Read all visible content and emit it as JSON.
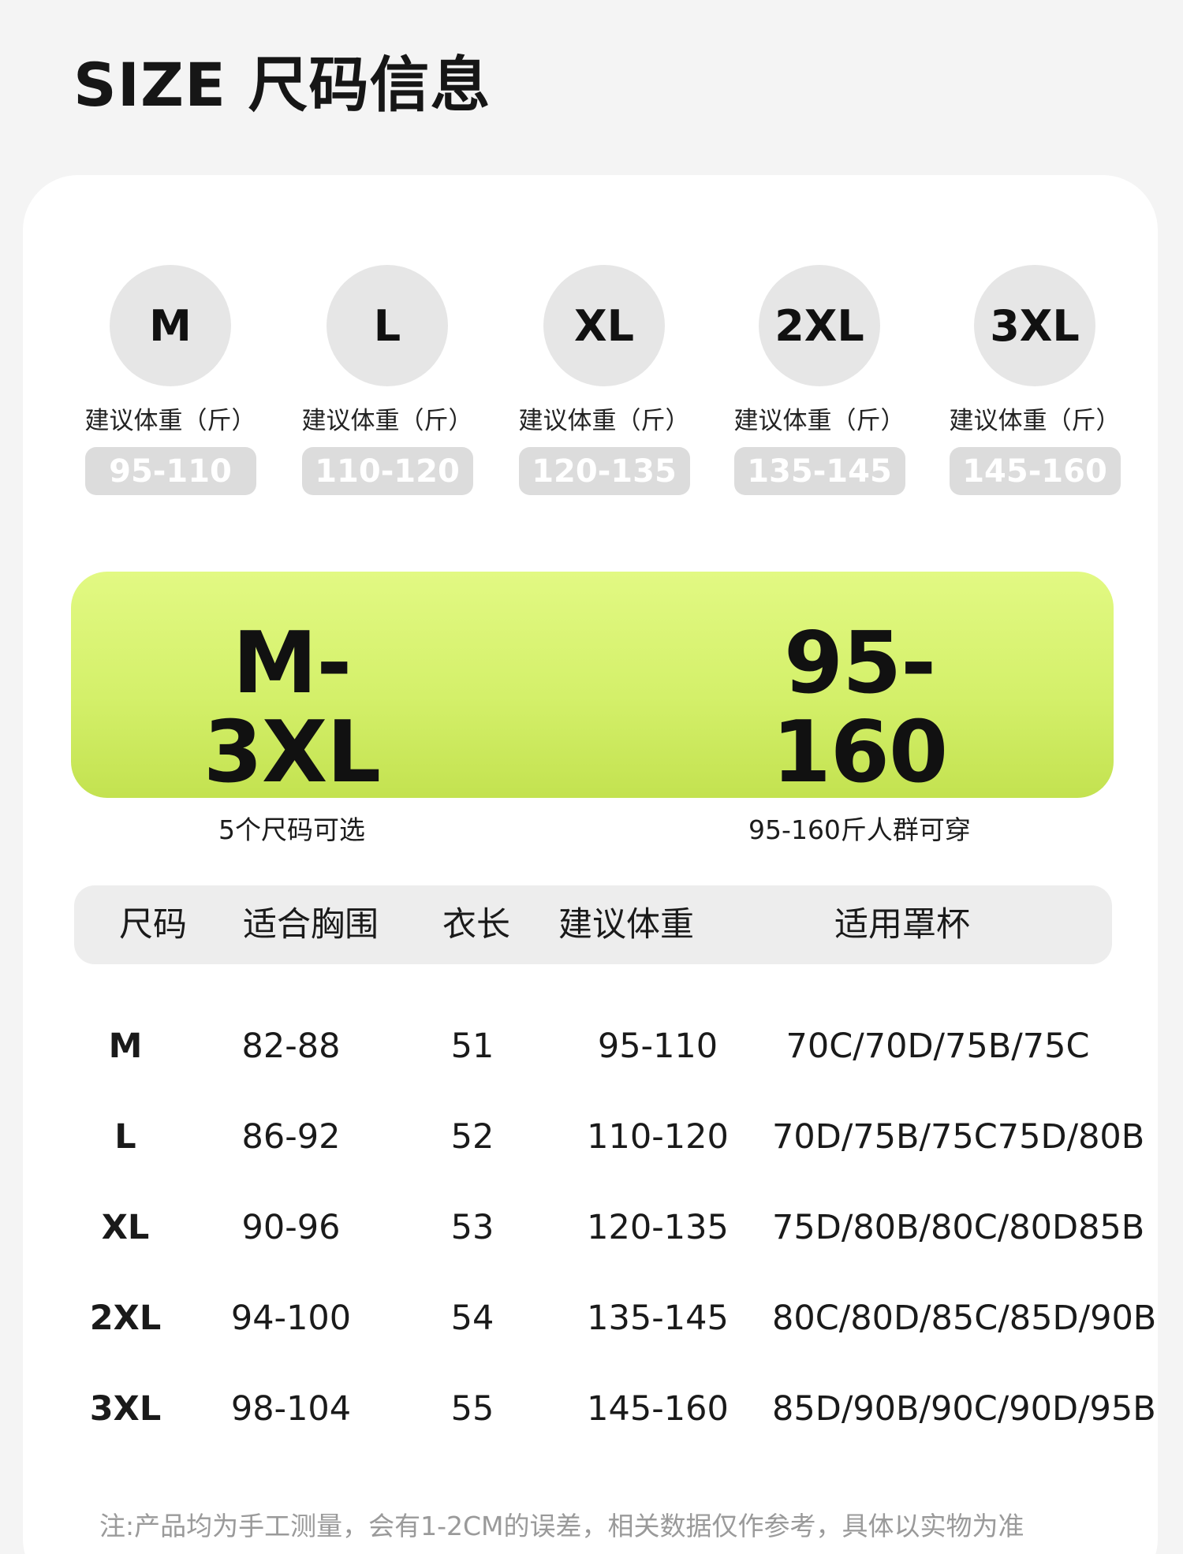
{
  "title": "SIZE 尺码信息",
  "sizes": [
    {
      "label": "M",
      "caption": "建议体重（斤）",
      "range": "95-110"
    },
    {
      "label": "L",
      "caption": "建议体重（斤）",
      "range": "110-120"
    },
    {
      "label": "XL",
      "caption": "建议体重（斤）",
      "range": "120-135"
    },
    {
      "label": "2XL",
      "caption": "建议体重（斤）",
      "range": "135-145"
    },
    {
      "label": "3XL",
      "caption": "建议体重（斤）",
      "range": "145-160"
    }
  ],
  "banner": {
    "left_big": "M-3XL",
    "left_small": "5个尺码可选",
    "right_big": "95-160",
    "right_small": "95-160斤人群可穿"
  },
  "table": {
    "headers": [
      "尺码",
      "适合胸围",
      "衣长",
      "建议体重",
      "适用罩杯"
    ],
    "rows": [
      [
        "M",
        "82-88",
        "51",
        "95-110",
        "70C/70D/75B/75C"
      ],
      [
        "L",
        "86-92",
        "52",
        "110-120",
        "70D/75B/75C75D/80B"
      ],
      [
        "XL",
        "90-96",
        "53",
        "120-135",
        "75D/80B/80C/80D85B"
      ],
      [
        "2XL",
        "94-100",
        "54",
        "135-145",
        "80C/80D/85C/85D/90B"
      ],
      [
        "3XL",
        "98-104",
        "55",
        "145-160",
        "85D/90B/90C/90D/95B"
      ]
    ]
  },
  "note": "注:产品均为手工测量，会有1-2CM的误差，相关数据仅作参考，具体以实物为准",
  "colors": {
    "page_bg": "#f4f4f4",
    "card_bg": "#ffffff",
    "circle_bg": "#e6e6e6",
    "range_pill_bg": "#dcdcdc",
    "banner_top": "#e2f983",
    "banner_bottom": "#c3e250",
    "header_bg": "#ededed",
    "note_text": "#9a9a9a"
  }
}
